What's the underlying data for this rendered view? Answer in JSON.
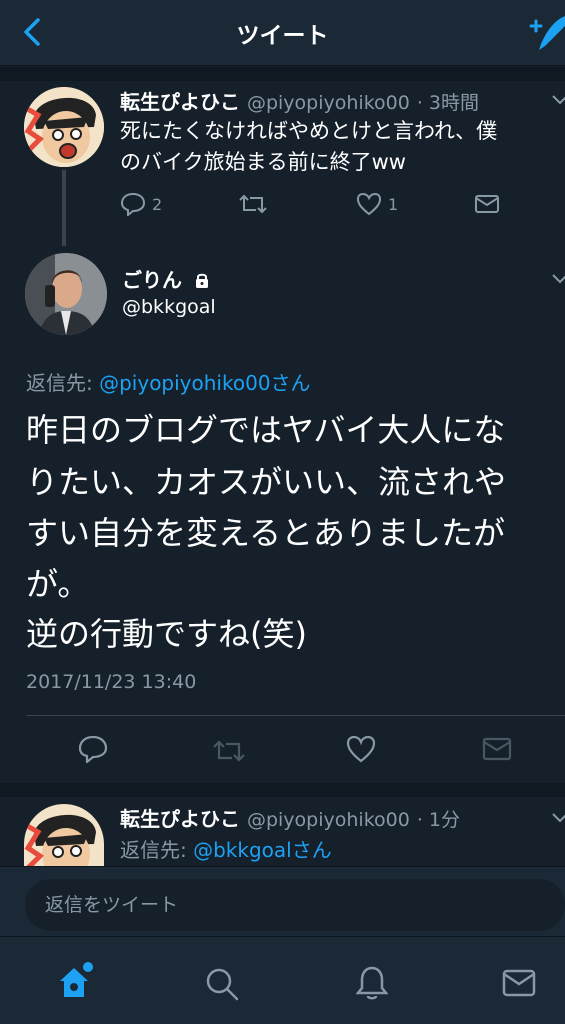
{
  "header": {
    "title": "ツイート"
  },
  "tweet1": {
    "name": "転生ぴよひこ",
    "handle": "@piyopiyohiko00",
    "time": "· 3時間",
    "line1": "死にたくなければやめとけと言われ、僕",
    "line2": "のバイク旅始まる前に終了ww",
    "reply_count": "2",
    "like_count": "1"
  },
  "main": {
    "name": "ごりん",
    "handle": "@bkkgoal",
    "reply_to_prefix": "返信先: ",
    "reply_to_link": "@piyopiyohiko00さん",
    "lines": [
      "昨日のブログではヤバイ大人にな",
      "りたい、カオスがいい、流されや",
      "すい自分を変えるとありましたが",
      "が。",
      "逆の行動ですね(笑)"
    ],
    "timestamp": "2017/11/23 13:40"
  },
  "tweet3": {
    "name": "転生ぴよひこ",
    "handle": "@piyopiyohiko00",
    "time": "· 1分",
    "reply_to_prefix": "返信先: ",
    "reply_to_link": "@bkkgoalさん"
  },
  "reply_bar": {
    "placeholder": "返信をツイート"
  },
  "colors": {
    "background": "#15202b",
    "accent": "#1da1f2",
    "muted": "#8899a6",
    "bar": "#1b2836"
  }
}
